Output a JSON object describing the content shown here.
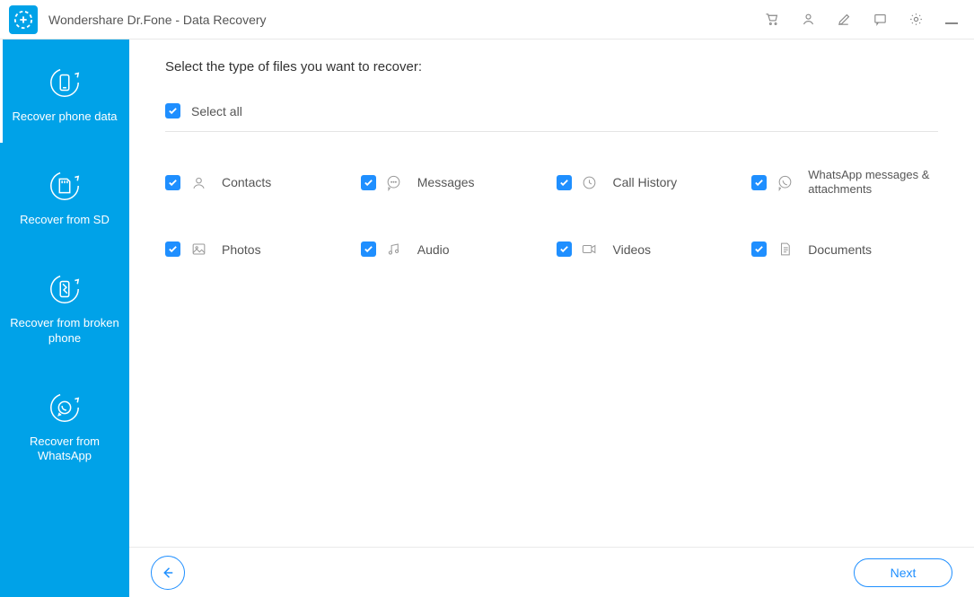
{
  "titlebar": {
    "app_title": "Wondershare Dr.Fone - Data Recovery"
  },
  "sidebar": {
    "items": [
      {
        "label": "Recover phone data"
      },
      {
        "label": "Recover from SD"
      },
      {
        "label": "Recover from broken phone"
      },
      {
        "label": "Recover from WhatsApp"
      }
    ]
  },
  "main": {
    "heading": "Select the type of files you want to recover:",
    "select_all_label": "Select all",
    "options": [
      {
        "label": "Contacts"
      },
      {
        "label": "Messages"
      },
      {
        "label": "Call History"
      },
      {
        "label": "WhatsApp messages & attachments"
      },
      {
        "label": "Photos"
      },
      {
        "label": "Audio"
      },
      {
        "label": "Videos"
      },
      {
        "label": "Documents"
      }
    ],
    "back_label": "Back",
    "next_label": "Next"
  },
  "colors": {
    "accent": "#00a2e8",
    "checkbox": "#1f8fff"
  }
}
